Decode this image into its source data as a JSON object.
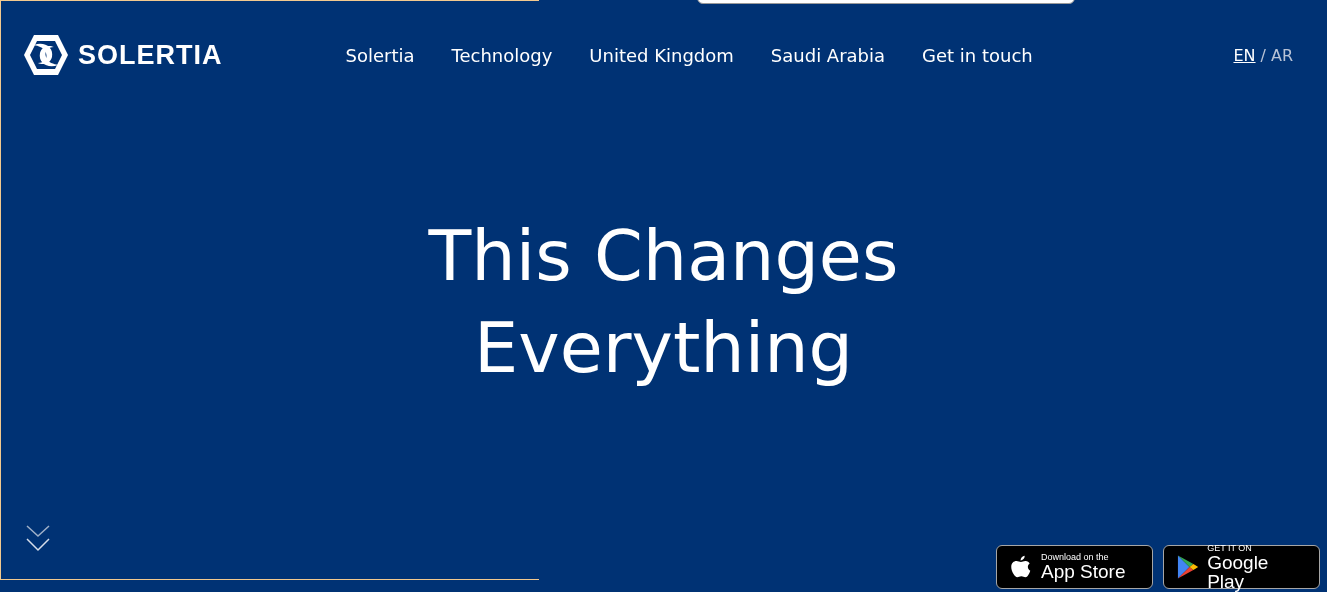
{
  "logo": {
    "text": "SOLERTIA"
  },
  "nav": [
    {
      "label": "Solertia"
    },
    {
      "label": "Technology"
    },
    {
      "label": "United Kingdom"
    },
    {
      "label": "Saudi Arabia"
    },
    {
      "label": "Get in touch"
    }
  ],
  "languages": {
    "separator": "/",
    "items": [
      {
        "label": "EN",
        "selected": true
      },
      {
        "label": "AR",
        "selected": false
      }
    ]
  },
  "hero": {
    "title_lines": [
      "This Changes",
      "Everything"
    ]
  },
  "store_badges": [
    {
      "kind": "apple",
      "small": "Download on the",
      "big": "App Store"
    },
    {
      "kind": "google",
      "small": "GET IT ON",
      "big": "Google Play"
    }
  ]
}
